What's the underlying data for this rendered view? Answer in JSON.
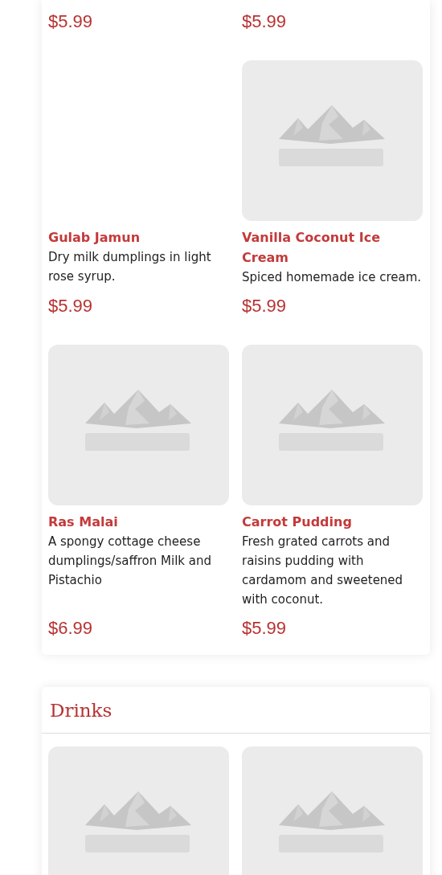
{
  "sections": [
    {
      "items": [
        {
          "kind": "text",
          "price": "$5.99"
        },
        {
          "kind": "text",
          "price": "$5.99"
        },
        {
          "kind": "blank",
          "name": "Gulab Jamun",
          "description": "Dry milk dumplings in light rose syrup.",
          "price": "$5.99"
        },
        {
          "kind": "picture",
          "name": "Vanilla Coconut Ice Cream",
          "description": "Spiced homemade ice cream.",
          "price": "$5.99"
        },
        {
          "kind": "picture",
          "name": "Ras Malai",
          "description": "A spongy cottage cheese dumplings/saffron Milk and Pistachio",
          "price": "$6.99"
        },
        {
          "kind": "picture",
          "name": "Carrot Pudding",
          "description": "Fresh grated carrots and raisins pudding with cardamom and sweetened with coconut.",
          "price": "$5.99"
        }
      ]
    },
    {
      "title": "Drinks"
    }
  ]
}
